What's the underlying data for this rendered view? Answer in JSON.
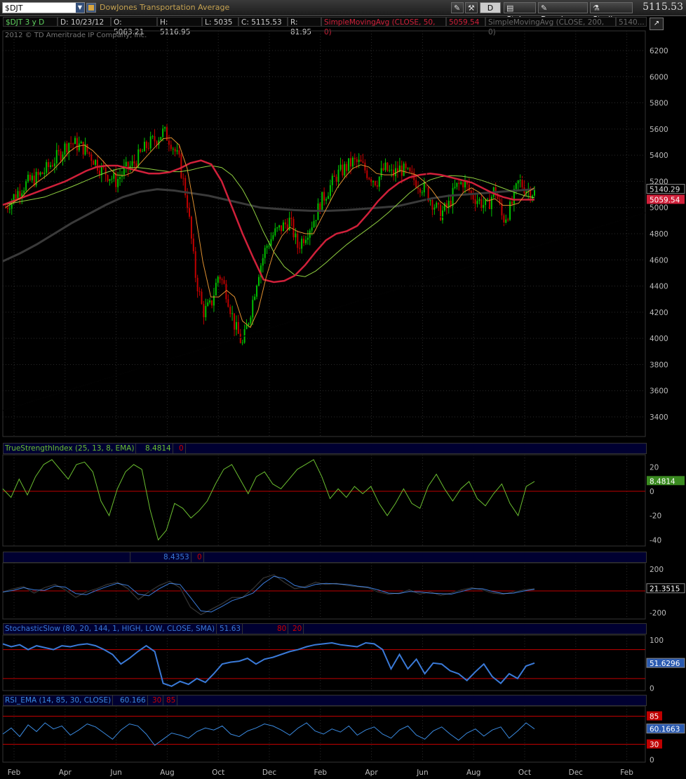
{
  "toolbar": {
    "symbol": "$DJT",
    "description": "DowJones Transportation Average",
    "style_label": "Style",
    "drawings_label": "Drawings",
    "studies_label": "Studies",
    "d_label": "D",
    "last_price": "5115.53"
  },
  "info": {
    "period": "$DJT 3 y D",
    "date": "D: 10/23/12",
    "open": "O: 5063.21",
    "high": "H: 5116.95",
    "low": "L: 5035",
    "close": "C: 5115.53",
    "range": "R: 81.95",
    "sma50_label": "SimpleMovingAvg (CLOSE, 50, 0)",
    "sma50_value": "5059.54",
    "sma200_label": "SimpleMovingAvg (CLOSE, 200, 0)",
    "sma200_value": "5140..."
  },
  "copyright": "2012 © TD Ameritrade IP Company, Inc.",
  "colors": {
    "background": "#000000",
    "grid": "#2a2a2a",
    "up_candle": "#00c000",
    "down_candle": "#c00000",
    "sma50": "#d0203a",
    "sma200": "#3a3a3a",
    "sma_green": "#90d040",
    "ema_orange": "#e09030",
    "tsi": "#6bbf30",
    "stoch": "#3a7ad8",
    "rsi": "#3a8ae0",
    "zero_line": "#c00000",
    "header_bg": "#000031"
  },
  "chart_data": [
    {
      "type": "candlestick",
      "price_axis": [
        "6200",
        "6000",
        "5800",
        "5600",
        "5400",
        "5200",
        "5000",
        "4800",
        "4600",
        "4400",
        "4200",
        "4000",
        "3800",
        "3600",
        "3400"
      ],
      "ylim": [
        3250,
        6350
      ],
      "x_labels": [
        "Feb",
        "Apr",
        "Jun",
        "Aug",
        "Oct",
        "Dec",
        "Feb",
        "Apr",
        "Jun",
        "Aug",
        "Oct",
        "Dec",
        "Feb"
      ],
      "annotations": {
        "sma200_tag": "5140.29",
        "sma50_tag": "5059.54"
      },
      "series_close": [
        5000,
        5080,
        5150,
        5200,
        5230,
        5280,
        5350,
        5420,
        5500,
        5480,
        5450,
        5380,
        5300,
        5250,
        5200,
        5280,
        5320,
        5400,
        5480,
        5520,
        5580,
        5500,
        5350,
        5050,
        4500,
        4200,
        4250,
        4500,
        4350,
        4100,
        3950,
        4200,
        4500,
        4700,
        4800,
        4850,
        4900,
        4700,
        4800,
        4900,
        5050,
        5150,
        5250,
        5300,
        5350,
        5330,
        5250,
        5200,
        5300,
        5250,
        5300,
        5250,
        5200,
        5150,
        5050,
        4950,
        5000,
        5150,
        5200,
        5100,
        5050,
        5000,
        5150,
        4900,
        5000,
        5200,
        5140,
        5115
      ],
      "sma50": [
        5020,
        5050,
        5080,
        5110,
        5140,
        5170,
        5200,
        5240,
        5280,
        5310,
        5320,
        5320,
        5300,
        5280,
        5260,
        5260,
        5270,
        5300,
        5340,
        5360,
        5330,
        5200,
        5000,
        4800,
        4620,
        4450,
        4430,
        4440,
        4480,
        4560,
        4660,
        4750,
        4800,
        4820,
        4860,
        4950,
        5050,
        5130,
        5190,
        5230,
        5250,
        5260,
        5250,
        5230,
        5210,
        5190,
        5150,
        5110,
        5080,
        5060,
        5060,
        5060
      ],
      "sma200": [
        4590,
        4650,
        4720,
        4800,
        4880,
        4950,
        5020,
        5080,
        5120,
        5140,
        5130,
        5110,
        5090,
        5060,
        5030,
        5000,
        4990,
        4980,
        4975,
        4975,
        4980,
        4990,
        5000,
        5010,
        5040,
        5070,
        5090,
        5100,
        5110,
        5120,
        5130,
        5140
      ]
    },
    {
      "type": "line",
      "title": "TrueStrengthIndex (25, 13, 8, EMA)",
      "value": "8.4814",
      "extra": "0",
      "axis": [
        "20",
        "0",
        "-20",
        "-40"
      ],
      "ylim": [
        -45,
        30
      ],
      "values": [
        2,
        -5,
        10,
        -3,
        12,
        22,
        26,
        18,
        10,
        22,
        24,
        16,
        -8,
        -20,
        2,
        16,
        22,
        18,
        -15,
        -40,
        -32,
        -10,
        -14,
        -22,
        -16,
        -8,
        6,
        18,
        22,
        10,
        -2,
        12,
        16,
        6,
        2,
        10,
        18,
        22,
        26,
        12,
        -6,
        2,
        -5,
        4,
        -2,
        4,
        -10,
        -20,
        -10,
        2,
        -10,
        -14,
        4,
        14,
        2,
        -8,
        2,
        8,
        -6,
        -12,
        -2,
        6,
        -10,
        -20,
        4,
        8
      ]
    },
    {
      "type": "line",
      "title": "",
      "value": "8.4353",
      "extra": "0",
      "axis": [
        "200",
        "21.3515",
        "-200"
      ],
      "ylim": [
        -260,
        260
      ],
      "values": [
        -10,
        20,
        40,
        -20,
        30,
        60,
        10,
        -60,
        -10,
        20,
        60,
        80,
        20,
        -80,
        -10,
        50,
        90,
        30,
        -150,
        -220,
        -170,
        -120,
        -60,
        -60,
        20,
        120,
        150,
        80,
        20,
        40,
        80,
        60,
        70,
        50,
        40,
        30,
        -10,
        -30,
        -20,
        10,
        -30,
        -10,
        -40,
        -20,
        10,
        30,
        10,
        -20,
        -30,
        -10,
        10,
        20
      ]
    },
    {
      "type": "line",
      "title": "StochasticSlow (80, 20, 144, 1, HIGH, LOW, CLOSE, SMA)",
      "value": "51.63",
      "params": [
        "80",
        "20"
      ],
      "axis": [
        "100",
        "51.6296",
        "0"
      ],
      "ylim": [
        -5,
        110
      ],
      "values": [
        92,
        86,
        90,
        80,
        88,
        84,
        80,
        88,
        86,
        90,
        92,
        88,
        80,
        70,
        50,
        62,
        76,
        88,
        76,
        10,
        4,
        14,
        8,
        20,
        12,
        30,
        50,
        54,
        56,
        62,
        50,
        60,
        64,
        70,
        76,
        80,
        86,
        90,
        92,
        94,
        90,
        88,
        86,
        94,
        92,
        80,
        40,
        70,
        40,
        60,
        30,
        52,
        50,
        36,
        30,
        16,
        34,
        50,
        24,
        10,
        30,
        20,
        46,
        52
      ]
    },
    {
      "type": "line",
      "title": "RSI_EMA (14, 85, 30, CLOSE)",
      "value": "60.166",
      "params": [
        "30",
        "85"
      ],
      "axis": [
        "85",
        "60.1663",
        "30",
        "0"
      ],
      "ylim": [
        -5,
        105
      ],
      "values": [
        50,
        62,
        45,
        68,
        55,
        72,
        60,
        66,
        48,
        58,
        70,
        64,
        52,
        40,
        58,
        70,
        66,
        50,
        28,
        40,
        52,
        48,
        42,
        55,
        62,
        58,
        66,
        50,
        45,
        56,
        62,
        70,
        66,
        58,
        48,
        62,
        72,
        56,
        50,
        60,
        54,
        66,
        48,
        58,
        64,
        50,
        42,
        58,
        66,
        48,
        40,
        56,
        64,
        50,
        38,
        52,
        60,
        46,
        58,
        64,
        42,
        56,
        72,
        60
      ]
    }
  ]
}
